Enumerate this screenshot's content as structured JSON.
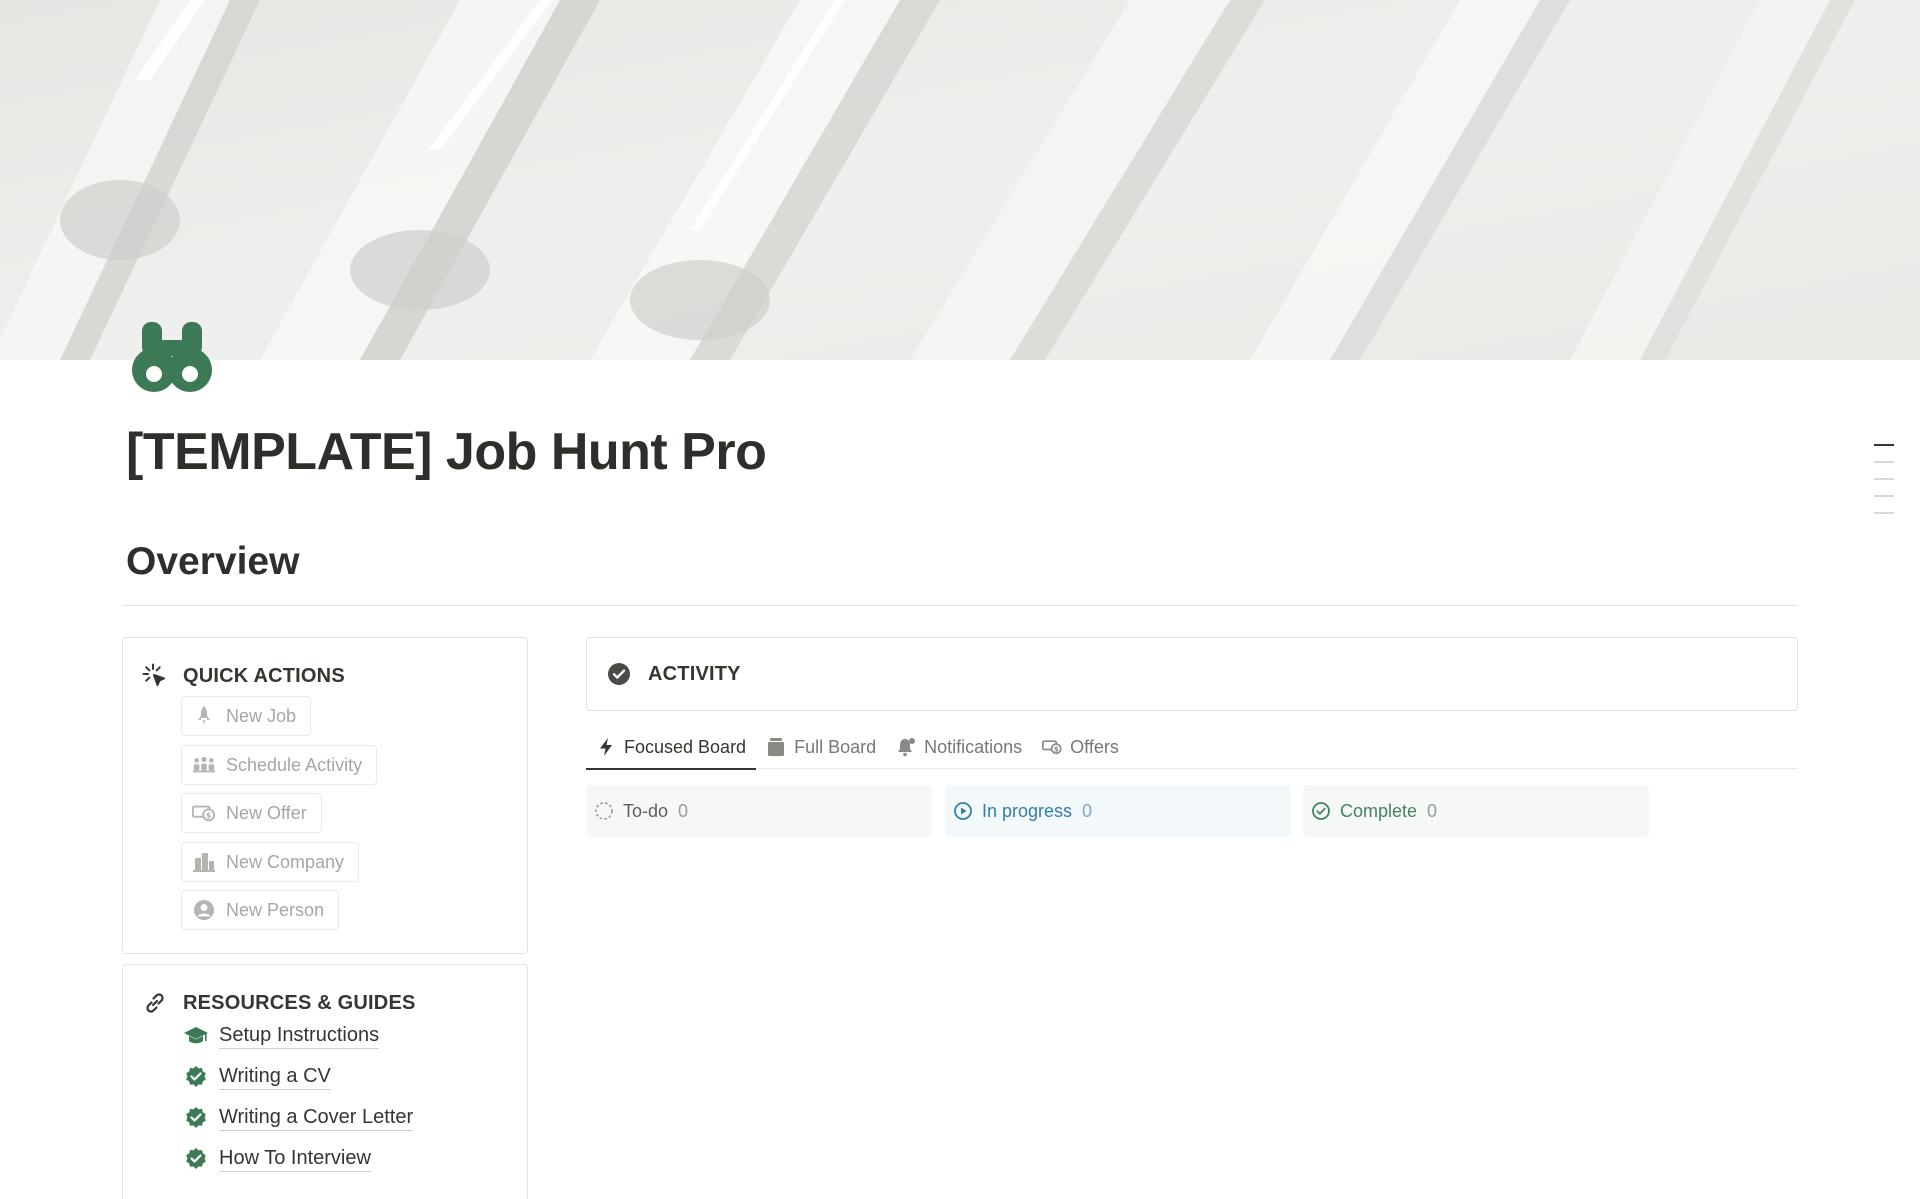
{
  "page": {
    "title": "[TEMPLATE] Job Hunt Pro",
    "icon": "binoculars-icon",
    "section_title": "Overview"
  },
  "colors": {
    "accent_green": "#3c7a55",
    "in_progress_blue": "#337ea9",
    "complete_green": "#448361"
  },
  "quick_actions": {
    "title": "QUICK ACTIONS",
    "icon": "cursor-click-icon",
    "buttons": [
      {
        "label": "New Job",
        "icon": "rocket-icon"
      },
      {
        "label": "Schedule Activity",
        "icon": "people-icon"
      },
      {
        "label": "New Offer",
        "icon": "money-icon"
      },
      {
        "label": "New Company",
        "icon": "building-icon"
      },
      {
        "label": "New Person",
        "icon": "person-circle-icon"
      }
    ]
  },
  "resources": {
    "title": "RESOURCES & GUIDES",
    "icon": "link-icon",
    "items": [
      {
        "label": "Setup Instructions",
        "icon": "graduation-cap-icon"
      },
      {
        "label": "Writing a CV",
        "icon": "verified-badge-icon"
      },
      {
        "label": "Writing a Cover Letter",
        "icon": "verified-badge-icon"
      },
      {
        "label": "How To Interview",
        "icon": "verified-badge-icon"
      }
    ]
  },
  "activity": {
    "title": "ACTIVITY",
    "icon": "check-circle-icon",
    "tabs": [
      {
        "label": "Focused Board",
        "icon": "lightning-icon",
        "active": true
      },
      {
        "label": "Full Board",
        "icon": "stack-icon",
        "active": false
      },
      {
        "label": "Notifications",
        "icon": "bell-icon",
        "active": false
      },
      {
        "label": "Offers",
        "icon": "money-icon",
        "active": false
      }
    ],
    "columns": [
      {
        "label": "To-do",
        "count": "0"
      },
      {
        "label": "In progress",
        "count": "0"
      },
      {
        "label": "Complete",
        "count": "0"
      }
    ]
  }
}
